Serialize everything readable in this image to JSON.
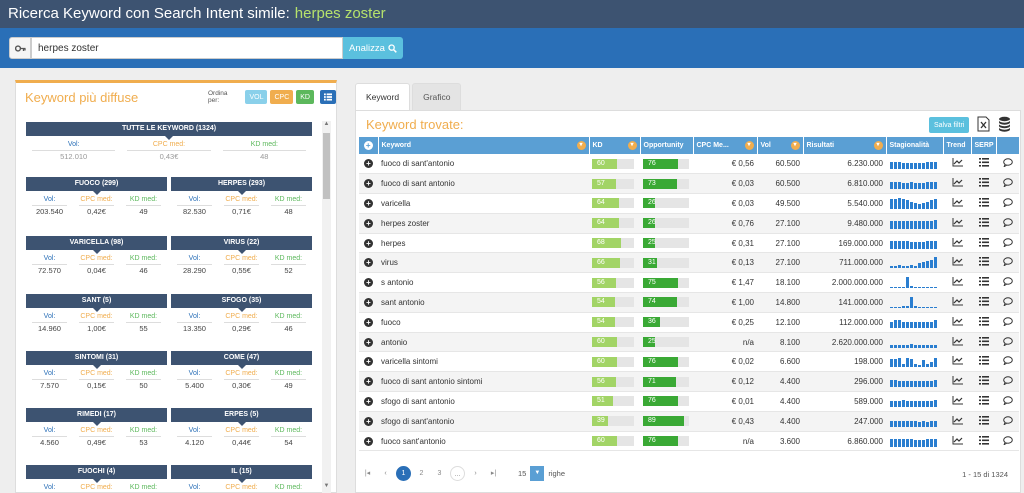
{
  "header": {
    "title": "Ricerca Keyword con Search Intent simile:",
    "keyword": "herpes zoster"
  },
  "search": {
    "value": "herpes zoster",
    "button_label": "Analizza",
    "icon": "key-icon"
  },
  "left_panel": {
    "title": "Keyword più diffuse",
    "sort_label": "Ordina per:",
    "sort_vol": "VOL",
    "sort_cpc": "CPC",
    "sort_kd": "KD",
    "labels": {
      "vol": "Vol:",
      "cpc": "CPC med:",
      "kd": "KD med:"
    },
    "all": {
      "title": "TUTTE LE KEYWORD (1324)",
      "vol": "512.010",
      "cpc": "0,43€",
      "kd": "48"
    },
    "groups": [
      {
        "title": "FUOCO (299)",
        "vol": "203.540",
        "cpc": "0,42€",
        "kd": "49"
      },
      {
        "title": "HERPES (293)",
        "vol": "82.530",
        "cpc": "0,71€",
        "kd": "48"
      },
      {
        "title": "VARICELLA (98)",
        "vol": "72.570",
        "cpc": "0,04€",
        "kd": "46"
      },
      {
        "title": "VIRUS (22)",
        "vol": "28.290",
        "cpc": "0,55€",
        "kd": "52"
      },
      {
        "title": "SANT (5)",
        "vol": "14.960",
        "cpc": "1,00€",
        "kd": "55"
      },
      {
        "title": "SFOGO (35)",
        "vol": "13.350",
        "cpc": "0,29€",
        "kd": "46"
      },
      {
        "title": "SINTOMI (31)",
        "vol": "7.570",
        "cpc": "0,15€",
        "kd": "50"
      },
      {
        "title": "COME (47)",
        "vol": "5.400",
        "cpc": "0,30€",
        "kd": "49"
      },
      {
        "title": "RIMEDI (17)",
        "vol": "4.560",
        "cpc": "0,49€",
        "kd": "53"
      },
      {
        "title": "ERPES (5)",
        "vol": "4.120",
        "cpc": "0,44€",
        "kd": "54"
      },
      {
        "title": "FUOCHI (4)",
        "vol": "",
        "cpc": "",
        "kd": ""
      },
      {
        "title": "IL (15)",
        "vol": "",
        "cpc": "",
        "kd": ""
      }
    ]
  },
  "tabs": [
    {
      "label": "Keyword",
      "active": true
    },
    {
      "label": "Grafico",
      "active": false
    }
  ],
  "right_panel": {
    "title": "Keyword trovate:",
    "save_filters": "Salva filtri",
    "columns": [
      "Keyword",
      "KD",
      "Opportunity",
      "CPC Me...",
      "Vol",
      "Risultati",
      "Stagionalità",
      "Trend",
      "SERP"
    ],
    "rows": [
      {
        "keyword": "fuoco di sant'antonio",
        "kd": 60,
        "opp": 76,
        "cpc": "€ 0,56",
        "vol": "60.500",
        "res": "6.230.000",
        "season": [
          6,
          6,
          6,
          5,
          5,
          5,
          5,
          5,
          5,
          6,
          6,
          6
        ]
      },
      {
        "keyword": "fuoco di sant antonio",
        "kd": 57,
        "opp": 73,
        "cpc": "€ 0,03",
        "vol": "60.500",
        "res": "6.810.000",
        "season": [
          6,
          6,
          6,
          5,
          5,
          6,
          5,
          5,
          5,
          6,
          6,
          6
        ]
      },
      {
        "keyword": "varicella",
        "kd": 64,
        "opp": 26,
        "cpc": "€ 0,03",
        "vol": "49.500",
        "res": "5.540.000",
        "season": [
          8,
          8,
          9,
          8,
          7,
          6,
          5,
          4,
          5,
          6,
          7,
          8
        ]
      },
      {
        "keyword": "herpes zoster",
        "kd": 64,
        "opp": 26,
        "cpc": "€ 0,76",
        "vol": "27.100",
        "res": "9.480.000",
        "season": [
          6,
          6,
          6,
          6,
          6,
          6,
          6,
          6,
          6,
          6,
          6,
          7
        ]
      },
      {
        "keyword": "herpes",
        "kd": 68,
        "opp": 25,
        "cpc": "€ 0,31",
        "vol": "27.100",
        "res": "169.000.000",
        "season": [
          6,
          6,
          6,
          6,
          6,
          5,
          5,
          5,
          5,
          6,
          6,
          6
        ]
      },
      {
        "keyword": "virus",
        "kd": 66,
        "opp": 31,
        "cpc": "€ 0,13",
        "vol": "27.100",
        "res": "711.000.000",
        "season": [
          2,
          2,
          3,
          2,
          2,
          3,
          2,
          4,
          5,
          6,
          7,
          9
        ]
      },
      {
        "keyword": "s antonio",
        "kd": 56,
        "opp": 75,
        "cpc": "€ 1,47",
        "vol": "18.100",
        "res": "2.000.000.000",
        "season": [
          1,
          1,
          1,
          1,
          9,
          2,
          1,
          1,
          1,
          1,
          1,
          1
        ]
      },
      {
        "keyword": "sant antonio",
        "kd": 54,
        "opp": 74,
        "cpc": "€ 1,00",
        "vol": "14.800",
        "res": "141.000.000",
        "season": [
          1,
          1,
          1,
          2,
          2,
          9,
          2,
          1,
          1,
          1,
          1,
          1
        ]
      },
      {
        "keyword": "fuoco",
        "kd": 54,
        "opp": 36,
        "cpc": "€ 0,25",
        "vol": "12.100",
        "res": "112.000.000",
        "season": [
          5,
          6,
          6,
          5,
          5,
          5,
          5,
          5,
          5,
          5,
          5,
          6
        ]
      },
      {
        "keyword": "antonio",
        "kd": 60,
        "opp": 25,
        "cpc": "n/a",
        "vol": "8.100",
        "res": "2.620.000.000",
        "season": [
          2,
          2,
          2,
          2,
          2,
          3,
          2,
          2,
          2,
          2,
          2,
          2
        ]
      },
      {
        "keyword": "varicella sintomi",
        "kd": 60,
        "opp": 76,
        "cpc": "€ 0,02",
        "vol": "6.600",
        "res": "198.000",
        "season": [
          7,
          7,
          8,
          3,
          8,
          7,
          3,
          2,
          6,
          3,
          4,
          8
        ]
      },
      {
        "keyword": "fuoco di sant antonio sintomi",
        "kd": 56,
        "opp": 71,
        "cpc": "€ 0,12",
        "vol": "4.400",
        "res": "296.000",
        "season": [
          6,
          6,
          5,
          5,
          5,
          5,
          5,
          5,
          5,
          5,
          5,
          6
        ]
      },
      {
        "keyword": "sfogo di sant antonio",
        "kd": 51,
        "opp": 76,
        "cpc": "€ 0,01",
        "vol": "4.400",
        "res": "589.000",
        "season": [
          5,
          5,
          5,
          6,
          5,
          5,
          5,
          5,
          5,
          5,
          5,
          6
        ]
      },
      {
        "keyword": "sfogo di sant'antonio",
        "kd": 39,
        "opp": 89,
        "cpc": "€ 0,43",
        "vol": "4.400",
        "res": "247.000",
        "season": [
          5,
          5,
          5,
          5,
          5,
          5,
          5,
          4,
          5,
          4,
          5,
          5
        ]
      },
      {
        "keyword": "fuoco sant'antonio",
        "kd": 60,
        "opp": 76,
        "cpc": "n/a",
        "vol": "3.600",
        "res": "6.860.000",
        "season": [
          6,
          6,
          6,
          6,
          6,
          6,
          5,
          5,
          5,
          6,
          6,
          6
        ]
      }
    ]
  },
  "pager": {
    "pages": [
      "1",
      "2",
      "3",
      "..."
    ],
    "per_page": "15",
    "per_page_label": "righe",
    "info": "1 - 15 di 1324"
  }
}
